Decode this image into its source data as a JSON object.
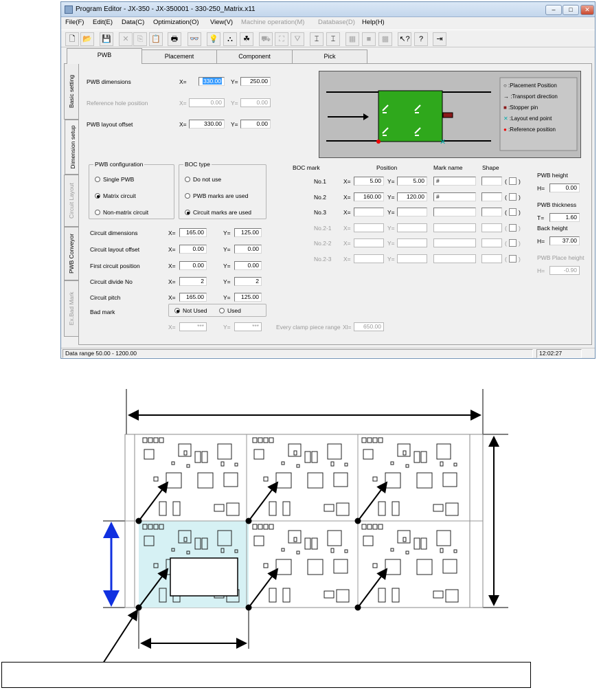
{
  "window": {
    "title": "Program Editor - JX-350 - JX-350001 - 330-250_Matrix.x11"
  },
  "window_buttons": {
    "minimize": "–",
    "maximize": "□",
    "close": "✕"
  },
  "menus": [
    "File(F)",
    "Edit(E)",
    "Data(C)",
    "Optimization(O)",
    "View(V)",
    "Machine operation(M)",
    "Database(D)",
    "Help(H)"
  ],
  "menus_disabled": [
    false,
    false,
    false,
    false,
    false,
    true,
    true,
    false
  ],
  "toolbar_icons": [
    "new-icon",
    "open-icon",
    "save-icon",
    "cut-icon",
    "copy-icon",
    "paste-icon",
    "print-icon",
    "find-icon",
    "light-icon",
    "teach-icon",
    "component-icon",
    "machine1-icon",
    "machine2-icon",
    "machine3-icon",
    "align1-icon",
    "align2-icon",
    "block1-icon",
    "block2-icon",
    "block3-icon",
    "whatsthis-icon",
    "help-icon",
    "exit-icon"
  ],
  "toolbar_glyphs": [
    "🗋",
    "📂",
    "💾",
    "✕",
    "⎘",
    "📋",
    "🖶",
    "👓",
    "💡",
    "⛬",
    "☘",
    "⛟",
    "⛶",
    "⛛",
    "⌶",
    "⌶",
    "▦",
    "■",
    "▩",
    "↖?",
    "?",
    "⇥"
  ],
  "tabs": [
    "PWB",
    "Placement",
    "Component",
    "Pick"
  ],
  "sidetabs": [
    "Basic setting",
    "Dimension setup",
    "Circuit Layout",
    "PWB Conveyor",
    "Ex.Bad Mark"
  ],
  "form": {
    "pwb_dimensions": {
      "label": "PWB dimensions",
      "x": "330.00",
      "y": "250.00"
    },
    "reference_hole": {
      "label": "Reference hole position",
      "x": "0.00",
      "y": "0.00"
    },
    "layout_offset": {
      "label": "PWB layout offset",
      "x": "330.00",
      "y": "0.00"
    },
    "x_prefix": "X=",
    "y_prefix": "Y="
  },
  "legend": [
    "Placement Position",
    "Transport direction",
    "Stopper pin",
    "Layout end point",
    "Reference position"
  ],
  "pwb_config": {
    "title": "PWB configuration",
    "options": [
      "Single PWB",
      "Matrix circuit",
      "Non-matrix circuit"
    ],
    "selected": 1
  },
  "boc_type": {
    "title": "BOC type",
    "options": [
      "Do not use",
      "PWB marks are used",
      "Circuit marks are used"
    ],
    "selected": 2
  },
  "circuit": {
    "dimensions": {
      "label": "Circuit dimensions",
      "x": "165.00",
      "y": "125.00"
    },
    "layout_offset": {
      "label": "Circuit layout offset",
      "x": "0.00",
      "y": "0.00"
    },
    "first_position": {
      "label": "First circuit position",
      "x": "0.00",
      "y": "0.00"
    },
    "divide_no": {
      "label": "Circuit divide No",
      "x": "2",
      "y": "2"
    },
    "pitch": {
      "label": "Circuit pitch",
      "x": "165.00",
      "y": "125.00"
    }
  },
  "bad_mark": {
    "label": "Bad mark",
    "options": [
      "Not Used",
      "Used"
    ],
    "selected": 0,
    "x": "***",
    "y": "***"
  },
  "boc": {
    "header": {
      "mark": "BOC mark",
      "position": "Position",
      "name": "Mark name",
      "shape": "Shape"
    },
    "rows": [
      {
        "no": "No.1",
        "x": "5.00",
        "y": "5.00",
        "name": "#",
        "enabled": true
      },
      {
        "no": "No.2",
        "x": "160.00",
        "y": "120.00",
        "name": "#",
        "enabled": true
      },
      {
        "no": "No.3",
        "x": "",
        "y": "",
        "name": "",
        "enabled": true
      },
      {
        "no": "No.2-1",
        "x": "",
        "y": "",
        "name": "",
        "enabled": false
      },
      {
        "no": "No.2-2",
        "x": "",
        "y": "",
        "name": "",
        "enabled": false
      },
      {
        "no": "No.2-3",
        "x": "",
        "y": "",
        "name": "",
        "enabled": false
      }
    ],
    "paren_open": "(",
    "paren_close": ")"
  },
  "clamp": {
    "label": "Every clamp piece range",
    "prefix": "Xl=",
    "value": "650.00"
  },
  "right_fields": {
    "height": {
      "label": "PWB height",
      "prefix": "H=",
      "value": "0.00"
    },
    "thickness": {
      "label": "PWB thickness",
      "prefix": "T=",
      "value": "1.60"
    },
    "back": {
      "label": "Back height",
      "prefix": "H=",
      "value": "37.00"
    },
    "place": {
      "label": "PWB Place height",
      "prefix": "H=",
      "value": "-0.90"
    }
  },
  "status": {
    "range": "Data range 50.00 - 1200.00",
    "time": "12:02:27"
  },
  "colors": {
    "board": "#2fa81c",
    "highlight": "#3399ff",
    "accent_arrow": "#1030e0",
    "circuit_fill": "#d6f1f4"
  }
}
